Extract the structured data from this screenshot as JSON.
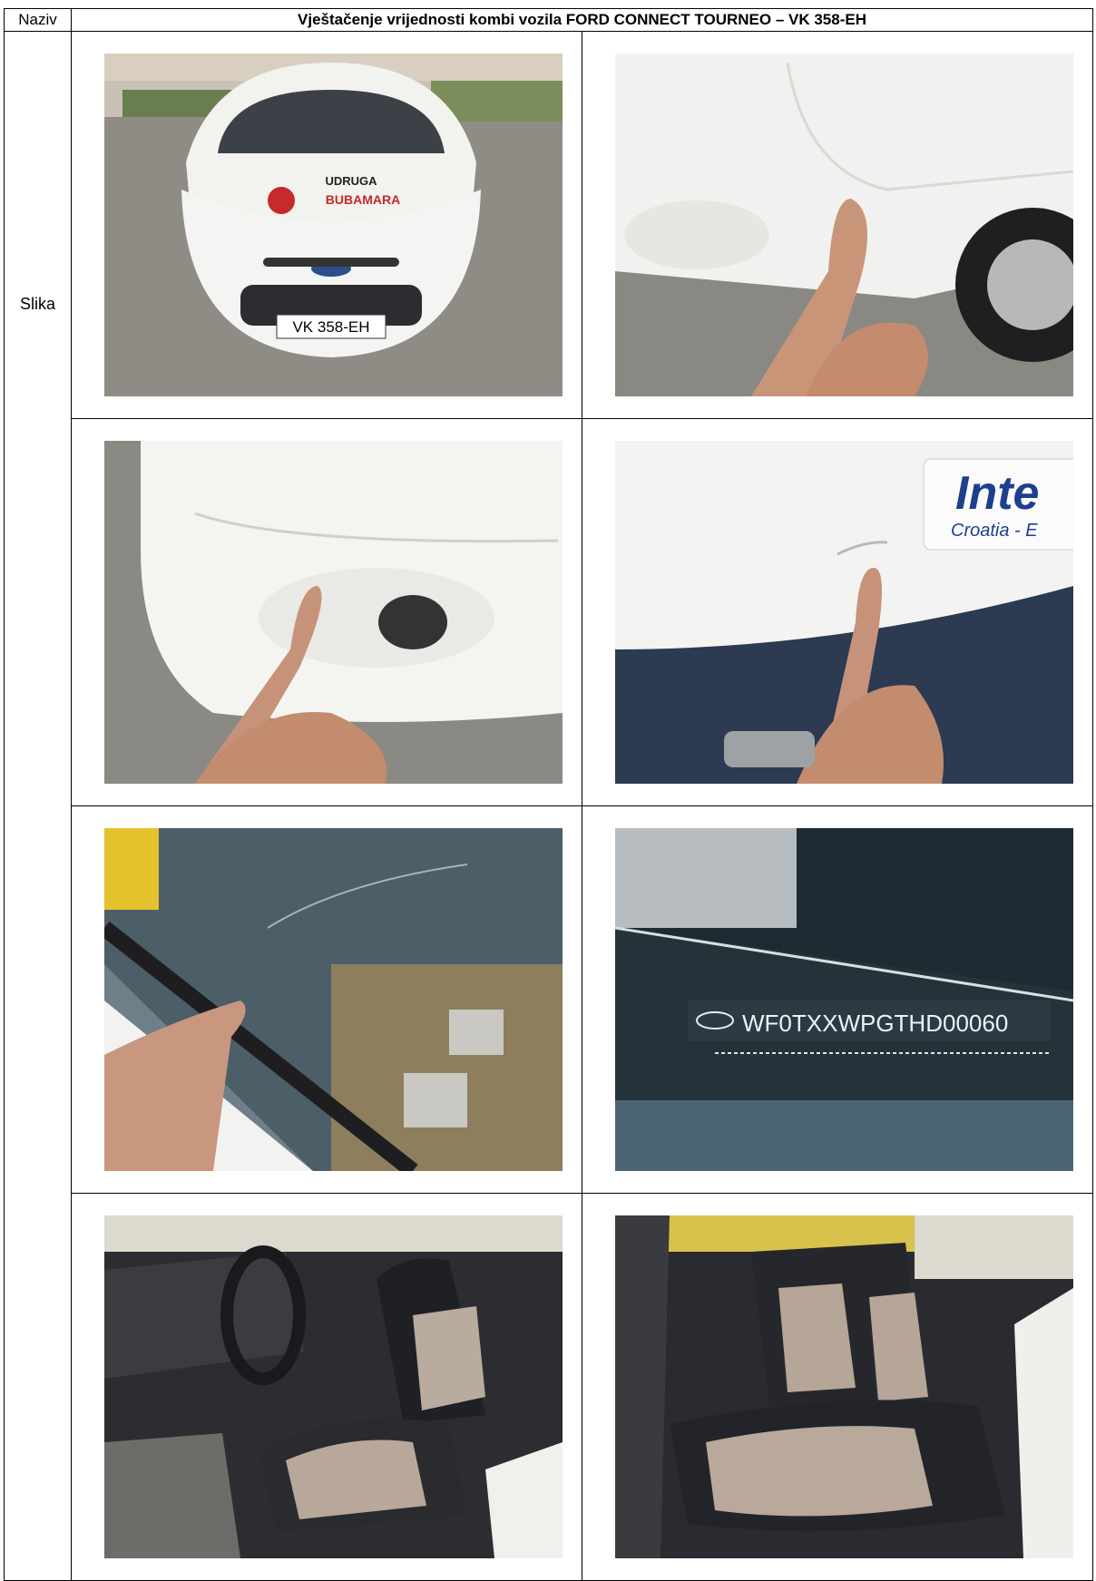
{
  "header": {
    "left_label": "Naziv",
    "title": "Vještačenje vrijednosti kombi vozila FORD CONNECT TOURNEO – VK 358-EH"
  },
  "row_label": "Slika",
  "photos": [
    {
      "id": "front-view",
      "plate_text": "VK 358-EH",
      "logo_line1": "UDRUGA",
      "logo_line2": "BUBAMARA"
    },
    {
      "id": "front-right-fender-damage"
    },
    {
      "id": "front-bumper-foglight-damage"
    },
    {
      "id": "side-panel-scratch",
      "decal_text1": "Inte",
      "decal_text2": "Croatia - E"
    },
    {
      "id": "windshield-crack"
    },
    {
      "id": "vin-plate",
      "vin_text": "WF0TXXWPGTHD00060"
    },
    {
      "id": "front-interior-seats"
    },
    {
      "id": "rear-interior-seats"
    }
  ],
  "colors": {
    "border": "#000000",
    "van_white": "#f4f4f2",
    "asphalt": "#8c8a86",
    "seat_dark": "#2a2b30",
    "seat_beige": "#b7a89a"
  }
}
